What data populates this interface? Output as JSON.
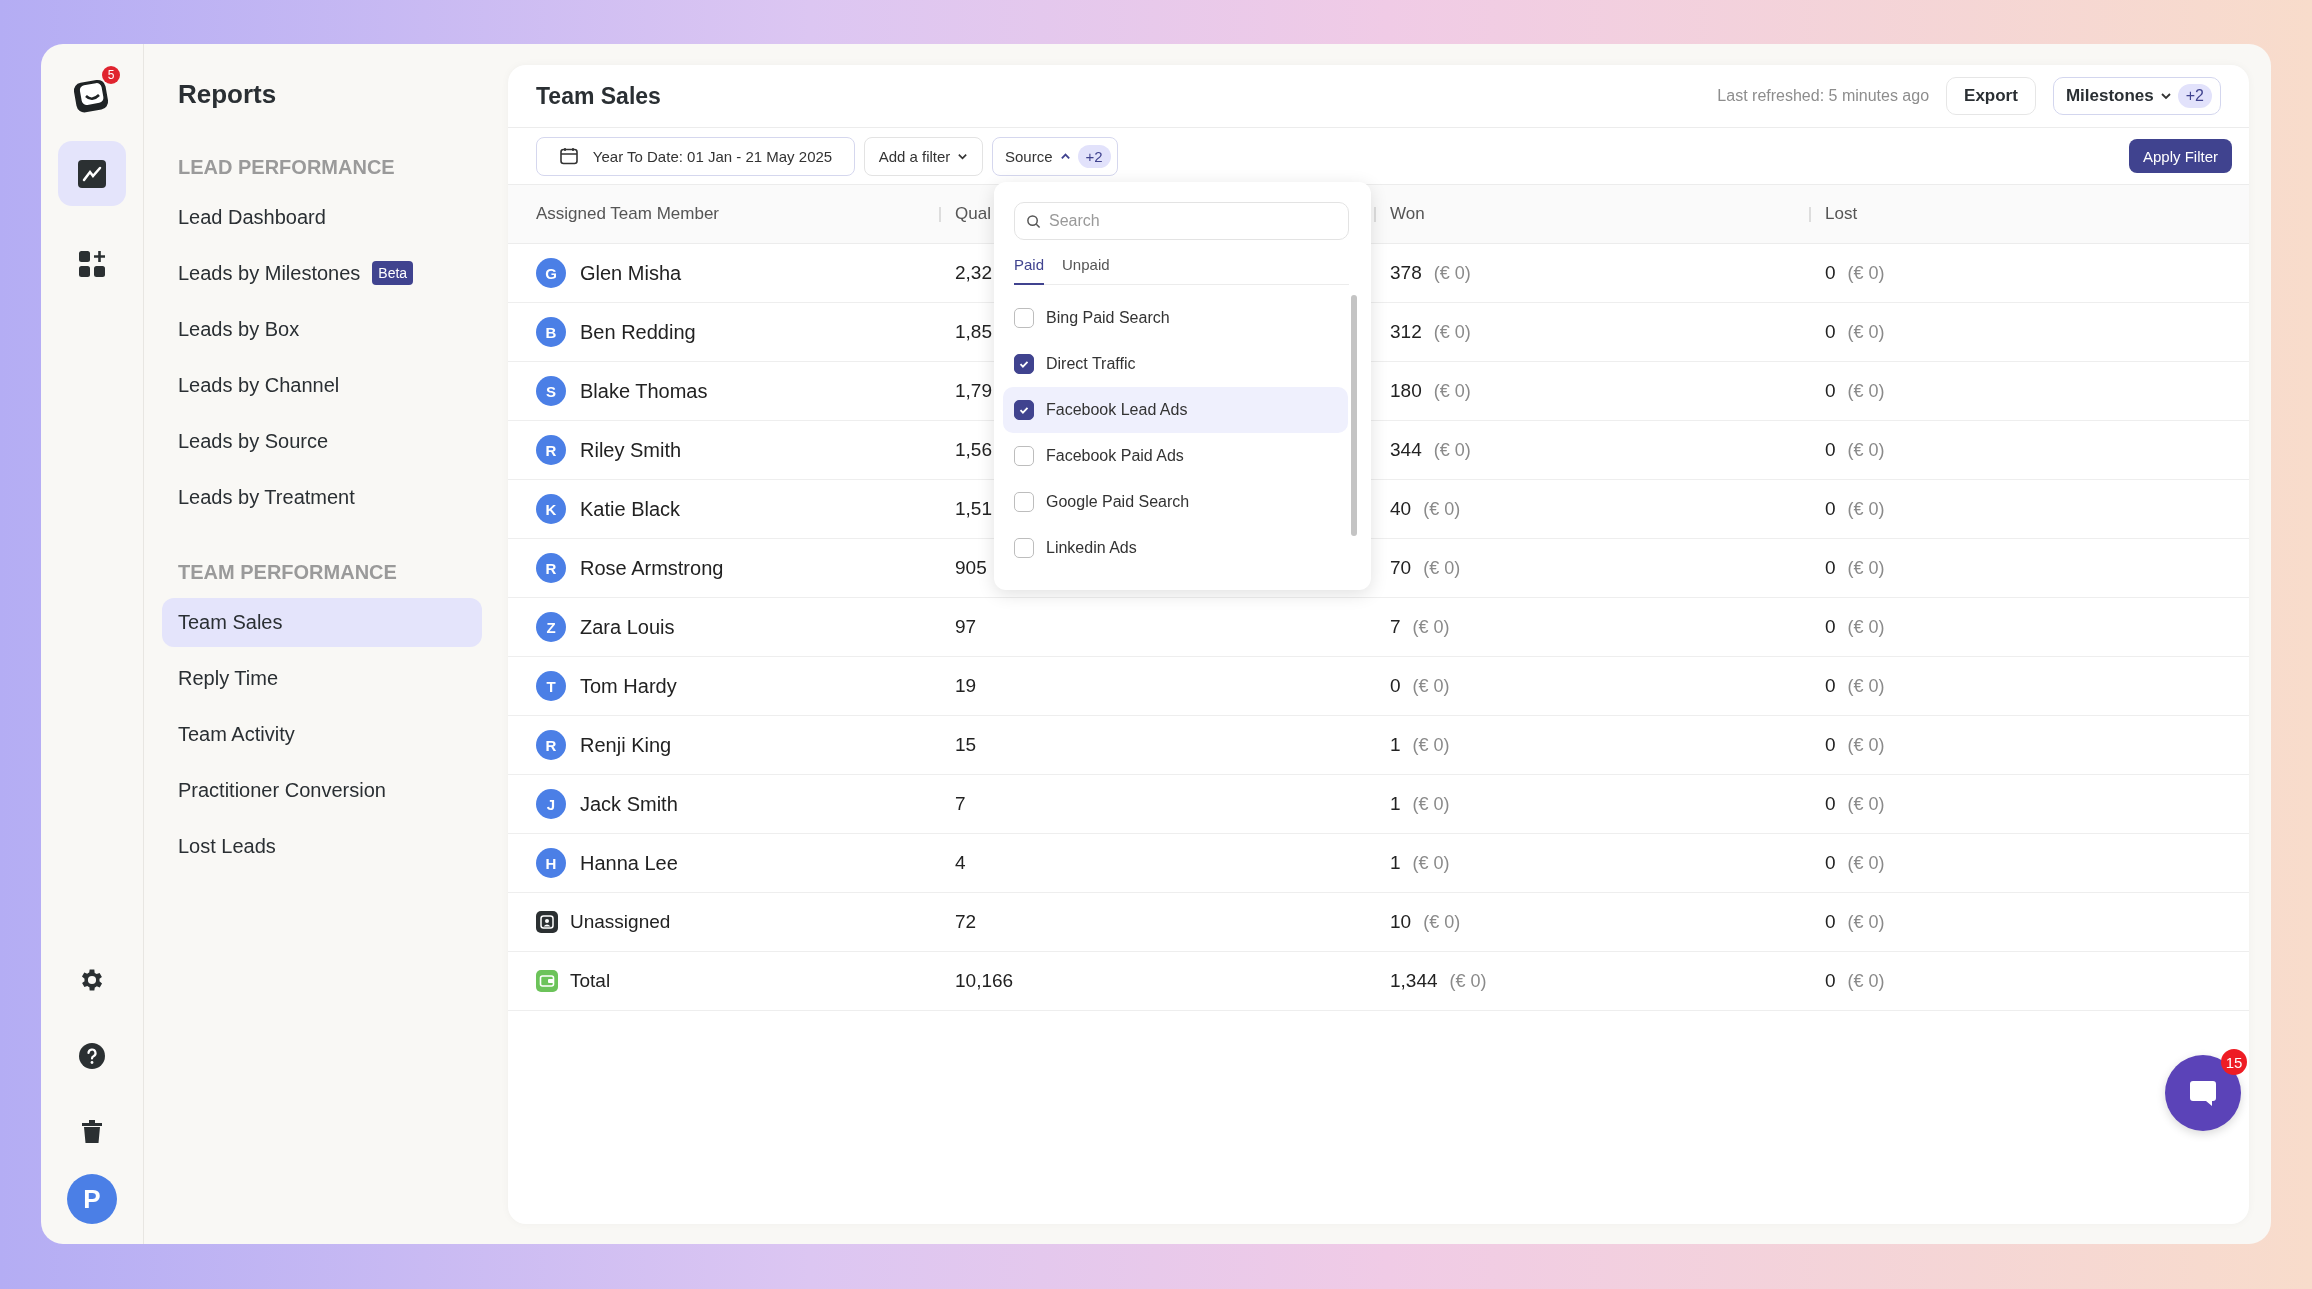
{
  "rail": {
    "logo_badge": "5",
    "nav": [
      {
        "kind": "chart",
        "selected": true
      },
      {
        "kind": "apps",
        "selected": false
      }
    ],
    "avatar": "P"
  },
  "sidebar": {
    "title": "Reports",
    "sections": [
      {
        "heading": "LEAD PERFORMANCE",
        "items": [
          {
            "label": "Lead Dashboard",
            "selected": false
          },
          {
            "label": "Leads by Milestones",
            "selected": false,
            "badge": "Beta"
          },
          {
            "label": "Leads by Box",
            "selected": false
          },
          {
            "label": "Leads by Channel",
            "selected": false
          },
          {
            "label": "Leads by Source",
            "selected": false
          },
          {
            "label": "Leads by Treatment",
            "selected": false
          }
        ]
      },
      {
        "heading": "TEAM PERFORMANCE",
        "items": [
          {
            "label": "Team Sales",
            "selected": true
          },
          {
            "label": "Reply Time",
            "selected": false
          },
          {
            "label": "Team Activity",
            "selected": false
          },
          {
            "label": "Practitioner Conversion",
            "selected": false
          },
          {
            "label": "Lost Leads",
            "selected": false
          }
        ]
      }
    ]
  },
  "main": {
    "title": "Team Sales",
    "last_refreshed": "Last refreshed: 5 minutes ago",
    "export": "Export",
    "milestones": {
      "label": "Milestones",
      "count": "+2"
    },
    "filters": {
      "date": "Year To Date: 01 Jan - 21 May 2025",
      "add_filter": "Add a filter",
      "source": {
        "label": "Source",
        "count": "+2",
        "expanded": true
      },
      "apply": "Apply Filter"
    },
    "table": {
      "columns": [
        "Assigned Team Member",
        "Qual",
        "Won",
        "Lost"
      ],
      "rows": [
        {
          "kind": "member",
          "initial": "G",
          "name": "Glen Misha",
          "qualified": "2,32",
          "won": "378",
          "won_value": "(€ 0)",
          "lost": "0",
          "lost_value": "(€ 0)"
        },
        {
          "kind": "member",
          "initial": "B",
          "name": "Ben Redding",
          "qualified": "1,85",
          "won": "312",
          "won_value": "(€ 0)",
          "lost": "0",
          "lost_value": "(€ 0)"
        },
        {
          "kind": "member",
          "initial": "S",
          "name": "Blake Thomas",
          "qualified": "1,79",
          "won": "180",
          "won_value": "(€ 0)",
          "lost": "0",
          "lost_value": "(€ 0)"
        },
        {
          "kind": "member",
          "initial": "R",
          "name": "Riley Smith",
          "qualified": "1,56",
          "won": "344",
          "won_value": "(€ 0)",
          "lost": "0",
          "lost_value": "(€ 0)"
        },
        {
          "kind": "member",
          "initial": "K",
          "name": "Katie Black",
          "qualified": "1,51",
          "won": "40",
          "won_value": "(€ 0)",
          "lost": "0",
          "lost_value": "(€ 0)"
        },
        {
          "kind": "member",
          "initial": "R",
          "name": "Rose Armstrong",
          "qualified": "905",
          "won": "70",
          "won_value": "(€ 0)",
          "lost": "0",
          "lost_value": "(€ 0)"
        },
        {
          "kind": "member",
          "initial": "Z",
          "name": "Zara Louis",
          "qualified": "97",
          "won": "7",
          "won_value": "(€ 0)",
          "lost": "0",
          "lost_value": "(€ 0)"
        },
        {
          "kind": "member",
          "initial": "T",
          "name": "Tom Hardy",
          "qualified": "19",
          "won": "0",
          "won_value": "(€ 0)",
          "lost": "0",
          "lost_value": "(€ 0)"
        },
        {
          "kind": "member",
          "initial": "R",
          "name": "Renji King",
          "qualified": "15",
          "won": "1",
          "won_value": "(€ 0)",
          "lost": "0",
          "lost_value": "(€ 0)"
        },
        {
          "kind": "member",
          "initial": "J",
          "name": "Jack Smith",
          "qualified": "7",
          "won": "1",
          "won_value": "(€ 0)",
          "lost": "0",
          "lost_value": "(€ 0)"
        },
        {
          "kind": "member",
          "initial": "H",
          "name": "Hanna Lee",
          "qualified": "4",
          "won": "1",
          "won_value": "(€ 0)",
          "lost": "0",
          "lost_value": "(€ 0)"
        },
        {
          "kind": "unassigned",
          "name": "Unassigned",
          "qualified": "72",
          "won": "10",
          "won_value": "(€ 0)",
          "lost": "0",
          "lost_value": "(€ 0)"
        },
        {
          "kind": "total",
          "name": "Total",
          "qualified": "10,166",
          "won": "1,344",
          "won_value": "(€ 0)",
          "lost": "0",
          "lost_value": "(€ 0)"
        }
      ]
    },
    "dropdown": {
      "search_placeholder": "Search",
      "tabs": [
        {
          "label": "Paid",
          "selected": true
        },
        {
          "label": "Unpaid",
          "selected": false
        }
      ],
      "options": [
        {
          "label": "Bing Paid Search",
          "checked": false,
          "highlighted": false
        },
        {
          "label": "Direct Traffic",
          "checked": true,
          "highlighted": false
        },
        {
          "label": "Facebook Lead Ads",
          "checked": true,
          "highlighted": true
        },
        {
          "label": "Facebook Paid Ads",
          "checked": false,
          "highlighted": false
        },
        {
          "label": "Google Paid Search",
          "checked": false,
          "highlighted": false
        },
        {
          "label": "Linkedin Ads",
          "checked": false,
          "highlighted": false
        }
      ]
    }
  },
  "chat": {
    "badge": "15"
  }
}
